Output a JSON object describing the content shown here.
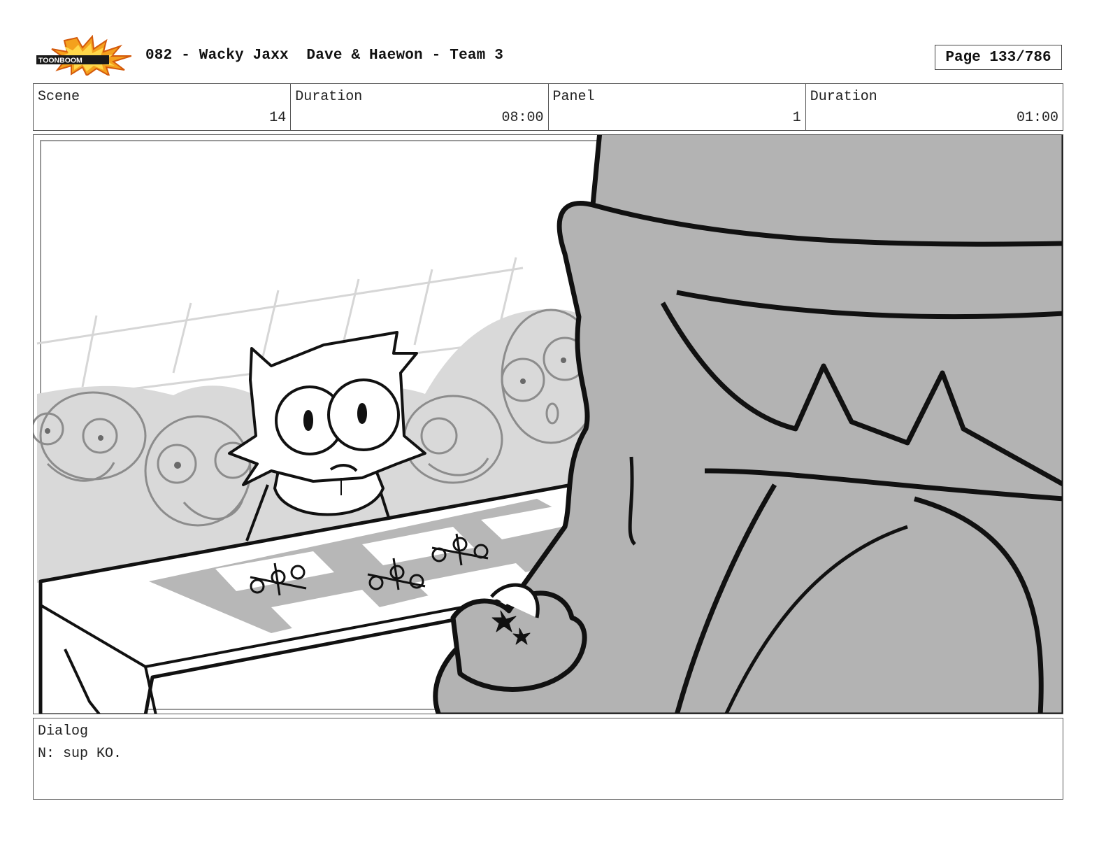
{
  "header": {
    "logo_text": "TOONBOOM",
    "title": "082 - Wacky Jaxx  Dave & Haewon - Team 3",
    "page": "Page 133/786"
  },
  "info": {
    "scene_label": "Scene",
    "scene_value": "14",
    "scene_duration_label": "Duration",
    "scene_duration_value": "08:00",
    "panel_label": "Panel",
    "panel_value": "1",
    "panel_duration_label": "Duration",
    "panel_duration_value": "01:00"
  },
  "dialog": {
    "label": "Dialog",
    "text": "N: sup KO."
  }
}
